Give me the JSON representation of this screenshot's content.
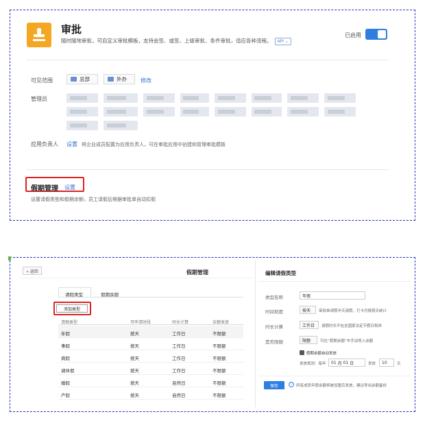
{
  "top": {
    "app_title": "审批",
    "app_desc": "随时随地审批，可自定义审批模板，支持会签、或签、上级审批、条件审批，适应各种流程。",
    "api_tag": "API",
    "status_label": "已启用",
    "visibility_label": "可见范围",
    "visibility_items": [
      "总部",
      "外办"
    ],
    "visibility_edit": "修改",
    "admin_label": "管理员",
    "owner_label": "应用负责人",
    "owner_link": "设置",
    "owner_hint": "将企业成员配置为应用负责人，可在审批应用中创建和管理审批模板",
    "holiday_title": "假期管理",
    "holiday_link": "设置",
    "holiday_hint": "设置请假类型和假期余额，员工请假后根据审批单自动扣假"
  },
  "bottom": {
    "back_label": "« 返回",
    "left_title": "假期管理",
    "tabs": [
      "请假类型",
      "假期余额"
    ],
    "add_button": "添加类型",
    "columns": [
      "请假类型",
      "可申请时段",
      "时长计算",
      "余额发放"
    ],
    "rows": [
      [
        "年假",
        "按天",
        "工作日",
        "不限额"
      ],
      [
        "事假",
        "按天",
        "工作日",
        "不限额"
      ],
      [
        "病假",
        "按天",
        "工作日",
        "不限额"
      ],
      [
        "调休假",
        "按天",
        "工作日",
        "不限额"
      ],
      [
        "婚假",
        "按天",
        "自然日",
        "不限额"
      ],
      [
        "产假",
        "按天",
        "自然日",
        "不限额"
      ]
    ],
    "right_title": "编辑请假类型",
    "form": {
      "name_label": "类型名称",
      "name_value": "年假",
      "unit_label": "时间刻度",
      "unit_value": "按天",
      "unit_hint": "审批单请假半天请假，打卡月报按天统计",
      "calc_label": "时长计算",
      "calc_value": "工作日",
      "calc_hint": "请假时长不包含国家法定节假日和休",
      "limit_label": "是否限额",
      "limit_value": "限额",
      "limit_hint": "可在“假期余额”中手动导入余额",
      "auto_label": "假期余额自动发放",
      "rule_label": "发放规则：每年",
      "rule_month": "01",
      "rule_month_unit": "月",
      "rule_day": "01",
      "rule_day_unit": "日",
      "rule_give": "发放",
      "rule_days": "10",
      "rule_days_unit": "天",
      "save": "保存",
      "save_hint": "所有成员年假余额将被设置后发放，建议导出余额备份"
    }
  }
}
